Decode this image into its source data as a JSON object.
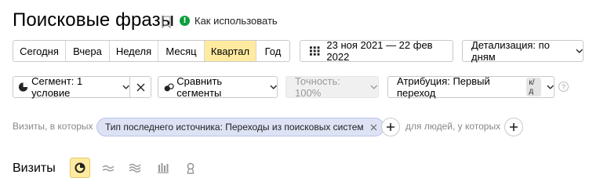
{
  "header": {
    "title": "Поисковые фразы",
    "how_to_use": "Как использовать"
  },
  "period": {
    "buttons": [
      "Сегодня",
      "Вчера",
      "Неделя",
      "Месяц",
      "Квартал",
      "Год"
    ],
    "active": "Квартал",
    "date_range": "23 ноя 2021 — 22 фев 2022",
    "detail": "Детализация: по дням"
  },
  "toolbar": {
    "segment": "Сегмент: 1 условие",
    "compare": "Сравнить сегменты",
    "accuracy": "Точность: 100%",
    "attribution": "Атрибуция: Первый переход",
    "attribution_badge": "к/д"
  },
  "filter": {
    "prefix": "Визиты, в которых",
    "chip": "Тип последнего источника: Переходы из поисковых систем",
    "people": "для людей, у которых"
  },
  "chart": {
    "label": "Визиты",
    "icons": [
      "pie-chart-icon",
      "line-chart-icon",
      "area-chart-icon",
      "bar-chart-icon",
      "map-icon"
    ],
    "active_icon": "pie-chart-icon"
  },
  "colors": {
    "active_bg": "#ffeba0",
    "chip_bg": "#dde3f5",
    "help_green": "#0e9e3e"
  }
}
